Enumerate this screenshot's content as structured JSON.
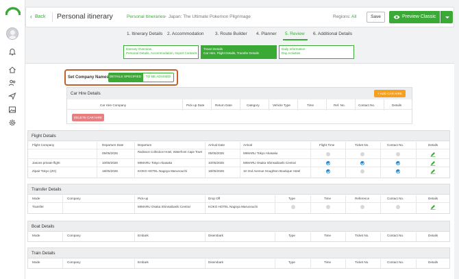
{
  "header": {
    "back_label": "Back",
    "page_title": "Personal itinerary",
    "breadcrumb_link": "Personal Itineraries",
    "breadcrumb_sep": ">",
    "breadcrumb_current": "Japan: The Ultimate Pokemon Pilgrimage",
    "regions_label": "Regions:",
    "regions_value": "All",
    "save_label": "Save",
    "preview_label": "Preview Classic"
  },
  "steps": [
    {
      "label": "1. Itinerary Details"
    },
    {
      "label": "2. Accommodation"
    },
    {
      "label": "3. Route Builder"
    },
    {
      "label": "4. Planner"
    },
    {
      "label": "5. Review"
    },
    {
      "label": "6. Additional Details"
    }
  ],
  "active_step": "5. Review",
  "subtabs": [
    {
      "title": "Itinerary Overview",
      "sub": "Personal Details, Accommodation, Import Contacts"
    },
    {
      "title": "Travel Details",
      "sub": "Car Hire, Flight Details, Transfer Details"
    },
    {
      "title": "Daily Information",
      "sub": "Day Activities"
    }
  ],
  "company_names": {
    "label": "Set Company Names to:",
    "option_specified": "DETAILS SPECIFIED",
    "option_tba": "TO BE ADVISED"
  },
  "car_hire": {
    "title": "Car Hire Details",
    "add_label": "+ ADD CAR HIRE",
    "delete_label": "DELETE CAR HIRE",
    "columns": [
      "Car Hire Company",
      "Pick-up Date",
      "Return Date",
      "Category",
      "Vehicle Type",
      "Time",
      "Ref. No.",
      "Contact No.",
      "Details"
    ]
  },
  "flights": {
    "title": "Flight Details",
    "columns": [
      "Flight Company",
      "Departure Date",
      "Departure",
      "Arrival Date",
      "Arrival",
      "Flight Time",
      "Ticket No.",
      "Contact No.",
      "Details"
    ],
    "rows": [
      {
        "company": "",
        "dep_date": "05/05/2026",
        "departure": "Radisson Collection Hotel, Waterfront Cape Town",
        "arr_date": "05/05/2026",
        "arrival": "MIMARU Tokyo Akasaka",
        "flight_time": false,
        "ticket": false,
        "contact": false
      },
      {
        "company": "Jasons private flight",
        "dep_date": "10/05/2026",
        "departure": "MIMARU Tokyo Akasaka",
        "arr_date": "10/05/2026",
        "arrival": "MIMARU Osaka Shinsaibashi Central",
        "flight_time": true,
        "ticket": true,
        "contact": true
      },
      {
        "company": "Zipair Tokyo (ZG)",
        "dep_date": "18/05/2026",
        "departure": "KOKO HOTEL Nagoya Marunouchi",
        "arr_date": "18/05/2026",
        "arrival": "10 2nd Avenue Houghton Boutique Hotel",
        "flight_time": true,
        "ticket": false,
        "contact": true
      }
    ]
  },
  "transfers": {
    "title": "Transfer Details",
    "columns": [
      "Mode",
      "Company",
      "Pick-up",
      "Drop Off",
      "Type",
      "Time",
      "Reference",
      "Contact No.",
      "Details"
    ],
    "rows": [
      {
        "mode": "Transfer",
        "company": "",
        "pickup": "MIMARU Osaka Shinsaibashi Central",
        "dropoff": "KOKO HOTEL Nagoya Marunouchi"
      }
    ]
  },
  "boats": {
    "title": "Boat Details",
    "columns": [
      "Mode",
      "Company",
      "Embark",
      "Disembark",
      "Type",
      "Time",
      "Ticket No.",
      "Contact No.",
      "Details"
    ]
  },
  "trains": {
    "title": "Train Details",
    "columns": [
      "Mode",
      "Company",
      "Embark",
      "Disembark",
      "Type",
      "Time",
      "Ticket No.",
      "Contact No.",
      "Details"
    ]
  },
  "colors": {
    "accent": "#3aa936",
    "warning_border": "#c0602a",
    "add_button": "#f5a020",
    "delete_button": "#e97d7f",
    "check_blue": "#1e88d6"
  },
  "icons": [
    "logo-arch-icon",
    "bell-icon",
    "home-icon",
    "users-icon",
    "paper-plane-icon",
    "image-icon",
    "gear-icon",
    "eye-icon",
    "pencil-icon",
    "chevron-left-icon"
  ]
}
